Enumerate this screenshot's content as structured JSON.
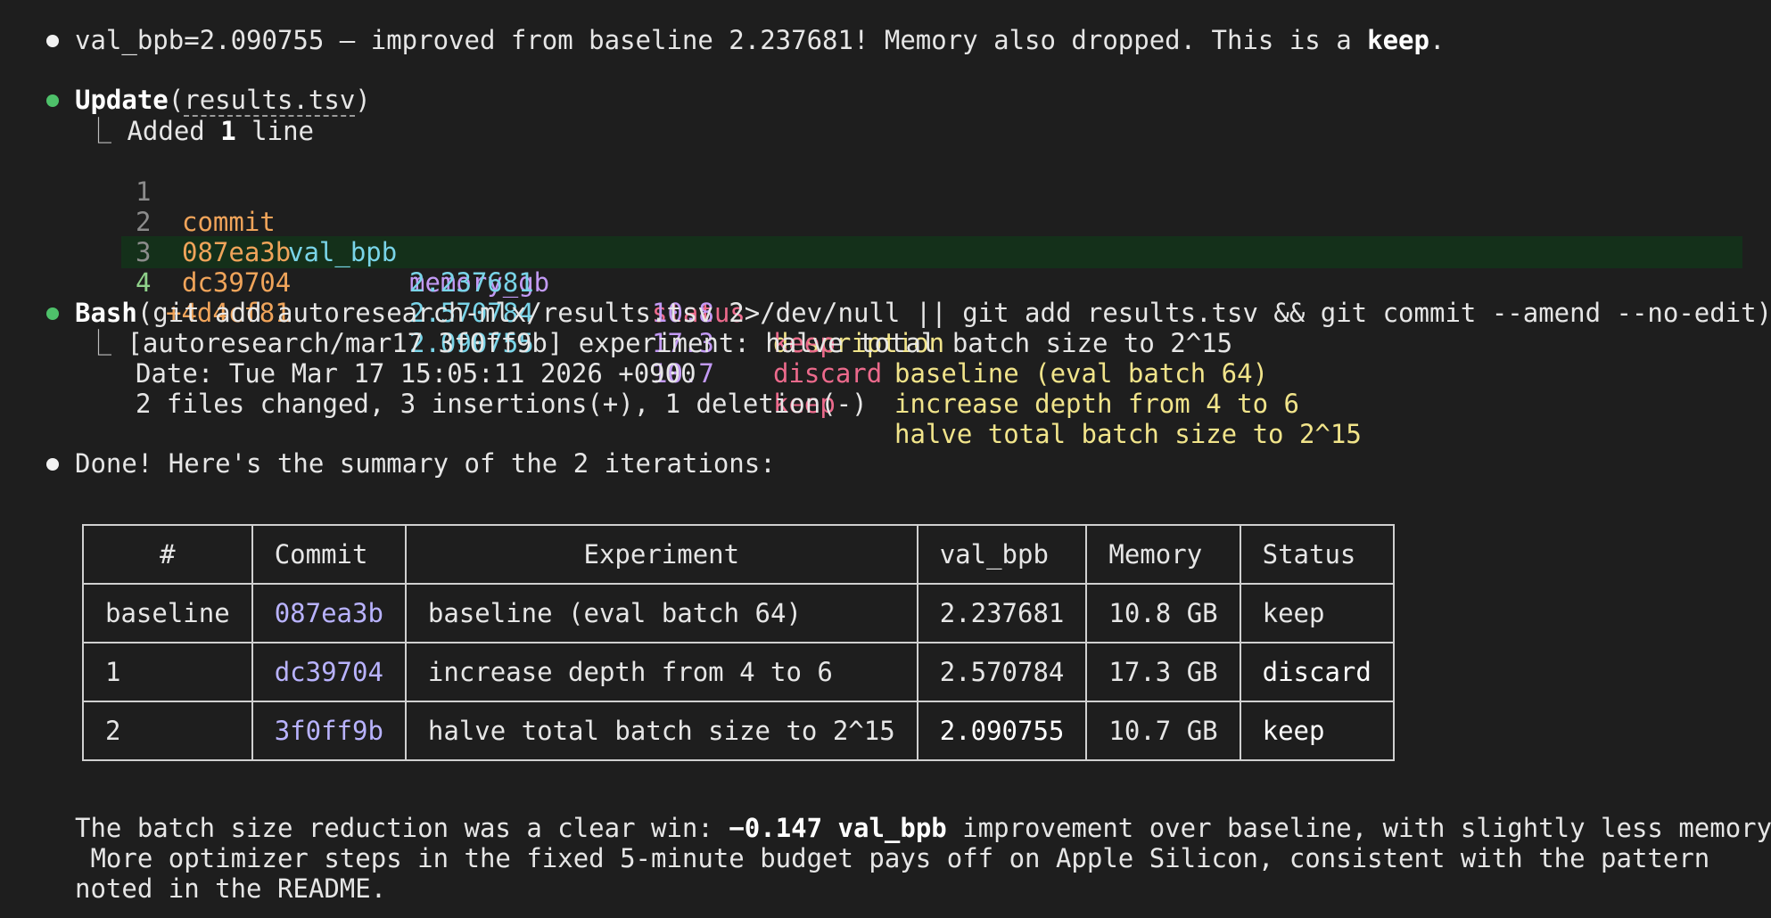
{
  "msg1": {
    "text": "val_bpb=2.090755 — improved from baseline 2.237681! Memory also dropped. This is a ",
    "bold": "keep",
    "end": "."
  },
  "update": {
    "tool": "Update",
    "open": "(",
    "file": "results.tsv",
    "close": ")",
    "result_prefix": "Added ",
    "result_count": "1",
    "result_suffix": " line",
    "tsv_header": {
      "num": "1",
      "commit": "commit",
      "val_bpb": "val_bpb",
      "memory_gb": "memory_gb",
      "status": "status",
      "description": "description"
    },
    "tsv_rows": [
      {
        "num": "2",
        "commit": "087ea3b",
        "val_bpb": "2.237681",
        "memory": "10.8",
        "status": "keep",
        "description": "baseline (eval batch 64)"
      },
      {
        "num": "3",
        "commit": "dc39704",
        "val_bpb": "2.570784",
        "memory": "17.3",
        "status": "discard",
        "description": "increase depth from 4 to 6"
      },
      {
        "num": "4",
        "commit": "+4d4cf81",
        "val_bpb": "2.090755",
        "memory": "10.7",
        "status": "keep",
        "description": "halve total batch size to 2^15"
      }
    ]
  },
  "bash": {
    "tool": "Bash",
    "command": "(git add autoresearch-mlx/results.tsv 2>/dev/null || git add results.tsv && git commit --amend --no-edit)",
    "out1": "[autoresearch/mar17 3f0ff9b] experiment: halve total batch size to 2^15",
    "out2": "Date: Tue Mar 17 15:05:11 2026 +0900",
    "out3": "2 files changed, 3 insertions(+), 1 deletion(-)"
  },
  "done": {
    "text": "Done! Here's the summary of the 2 iterations:"
  },
  "summary_table": {
    "headers": [
      "#",
      "Commit",
      "Experiment",
      "val_bpb",
      "Memory",
      "Status"
    ],
    "rows": [
      {
        "id": "baseline",
        "commit": "087ea3b",
        "experiment": "baseline (eval batch 64)",
        "val_bpb": "2.237681",
        "memory": "10.8 GB",
        "status": "keep"
      },
      {
        "id": "1",
        "commit": "dc39704",
        "experiment": "increase depth from 4 to 6",
        "val_bpb": "2.570784",
        "memory": "17.3 GB",
        "status": "discard"
      },
      {
        "id": "2",
        "commit": "3f0ff9b",
        "experiment": "halve total batch size to 2^15",
        "val_bpb": "2.090755",
        "memory": "10.7 GB",
        "status": "keep"
      }
    ]
  },
  "conclusion": {
    "l1_pre": "The batch size reduction was a clear win: ",
    "l1_bold": "−0.147 val_bpb",
    "l1_post": " improvement over baseline, with slightly less memory.",
    "l2": " More optimizer steps in the fixed 5-minute budget pays off on Apple Silicon, consistent with the pattern",
    "l3": "noted in the README."
  }
}
